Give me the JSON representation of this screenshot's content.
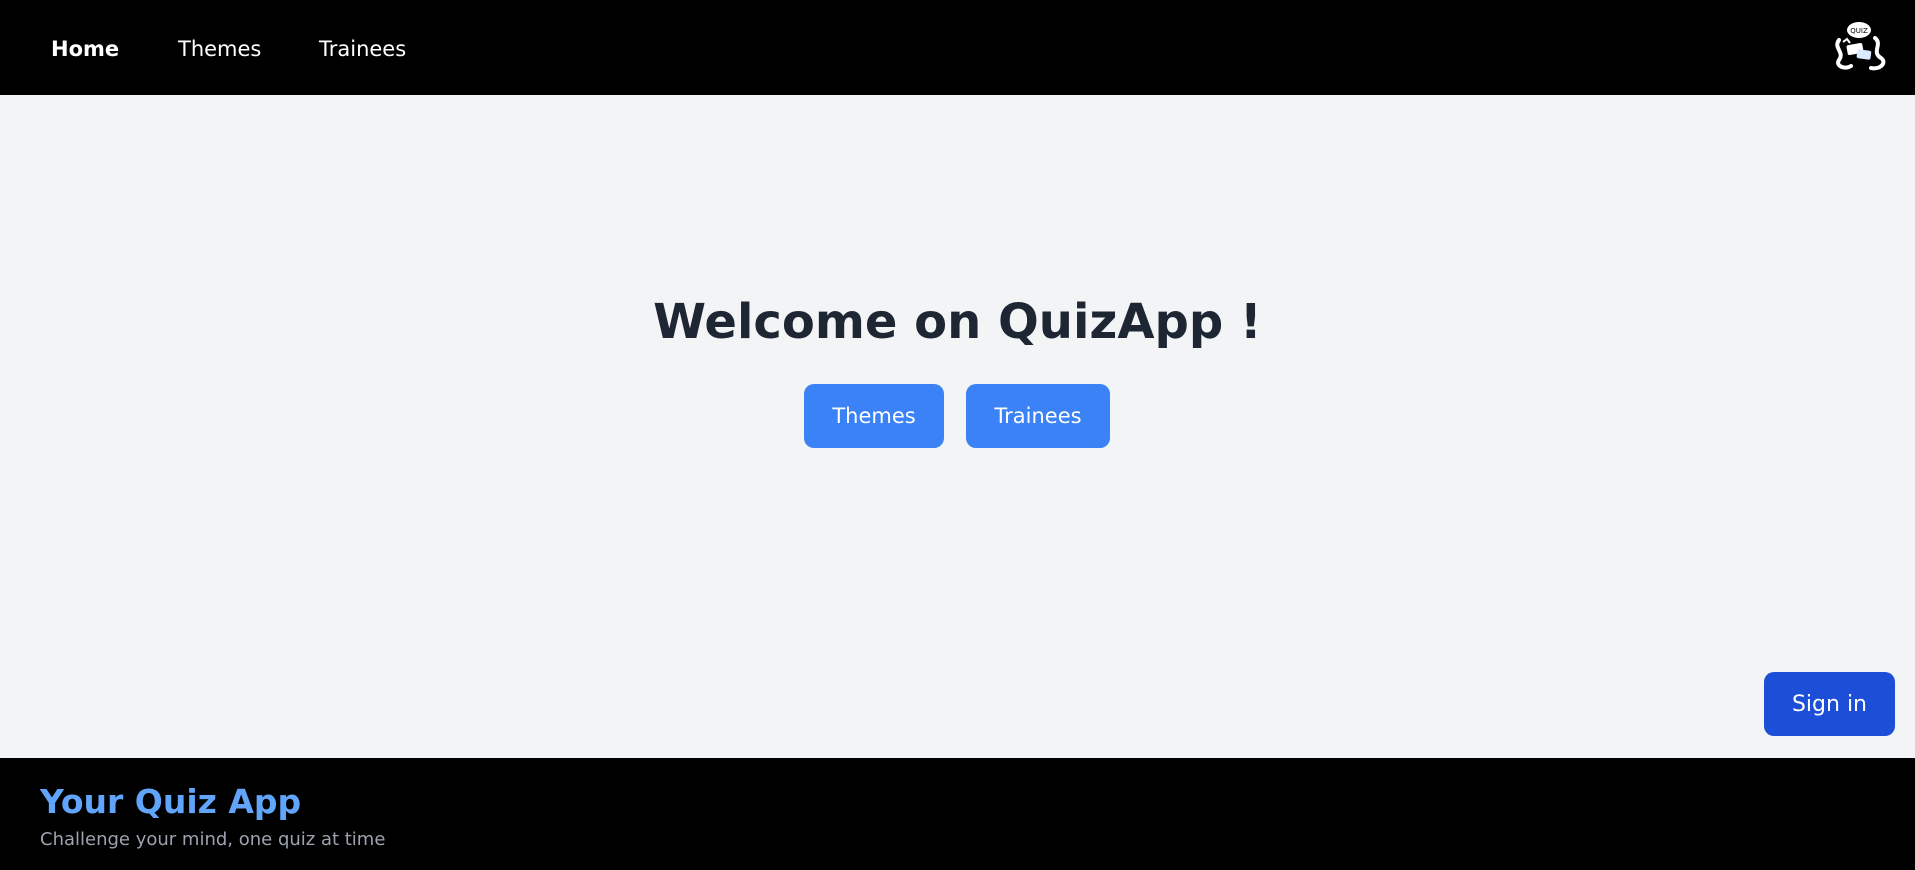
{
  "navbar": {
    "items": [
      {
        "label": "Home",
        "active": true
      },
      {
        "label": "Themes",
        "active": false
      },
      {
        "label": "Trainees",
        "active": false
      }
    ],
    "logo_icon": "quiz-mascot-icon",
    "logo_text": "QUIZ"
  },
  "main": {
    "heading": "Welcome on QuizApp !",
    "buttons": [
      {
        "label": "Themes"
      },
      {
        "label": "Trainees"
      }
    ],
    "signin_label": "Sign in"
  },
  "footer": {
    "title": "Your Quiz App",
    "subtitle": "Challenge your mind, one quiz at time"
  },
  "colors": {
    "nav_bg": "#000000",
    "page_bg": "#f2f4f6",
    "primary_button": "#3b82f6",
    "signin_button": "#1d4ed8",
    "footer_title": "#60a5fa",
    "heading": "#1e2634"
  }
}
